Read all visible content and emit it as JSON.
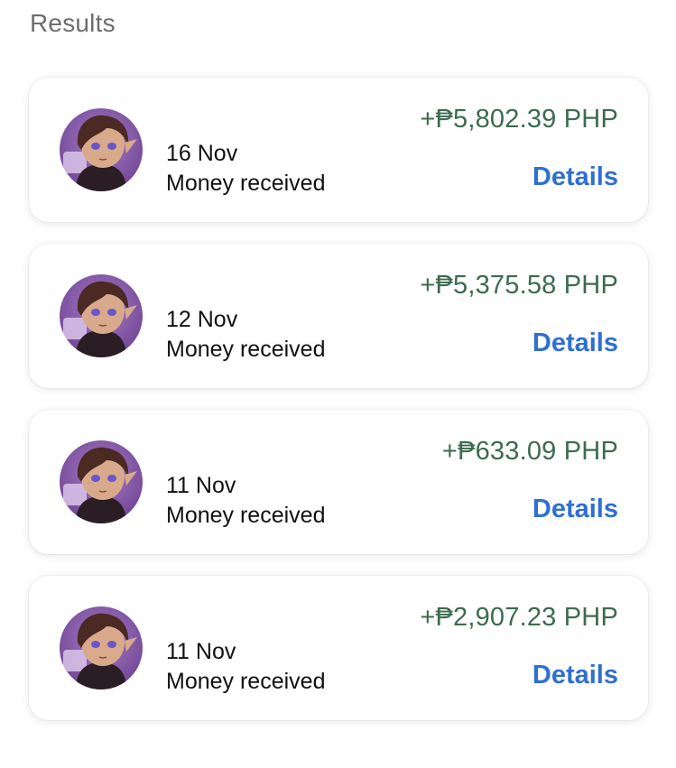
{
  "header": {
    "title": "Results"
  },
  "transactions": [
    {
      "date": "16 Nov",
      "description": "Money received",
      "amount": "+₱5,802.39 PHP",
      "action": "Details"
    },
    {
      "date": "12 Nov",
      "description": "Money received",
      "amount": "+₱5,375.58 PHP",
      "action": "Details"
    },
    {
      "date": "11 Nov",
      "description": "Money received",
      "amount": "+₱633.09 PHP",
      "action": "Details"
    },
    {
      "date": "11 Nov",
      "description": "Money received",
      "amount": "+₱2,907.23 PHP",
      "action": "Details"
    }
  ],
  "colors": {
    "amount_positive": "#3c6b4f",
    "link": "#2f6fd0",
    "heading": "#6d6d6d",
    "avatar_bg": "#7a4f9c"
  },
  "icons": {
    "avatar": "user-avatar-icon"
  }
}
